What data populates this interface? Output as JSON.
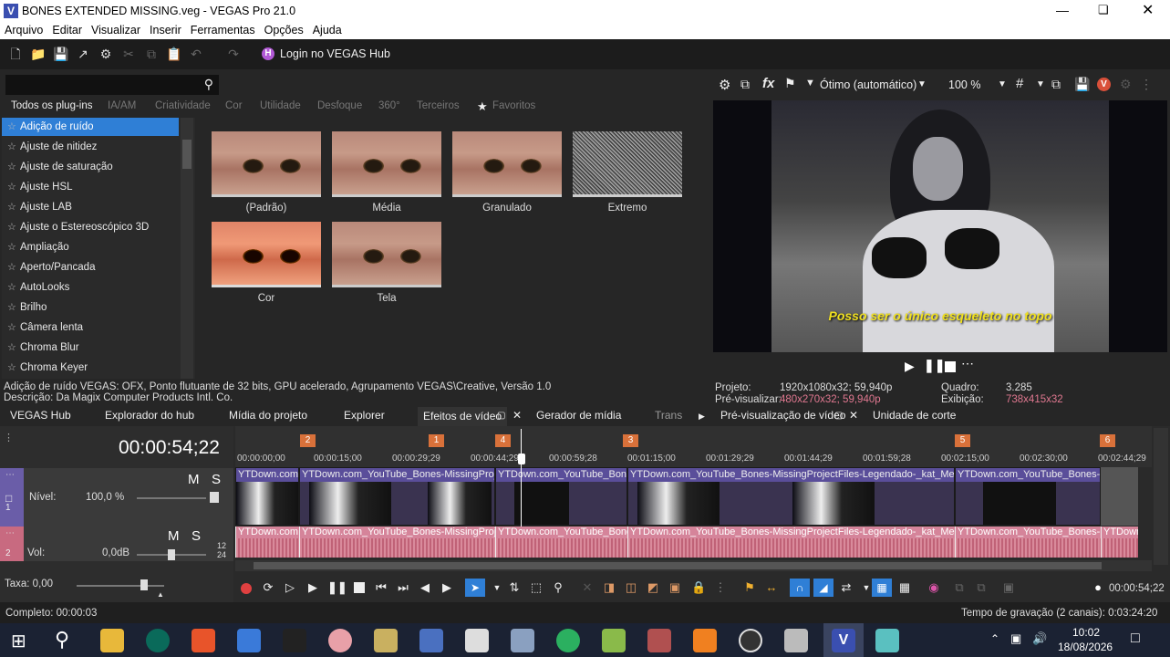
{
  "window": {
    "title": "BONES EXTENDED MISSING.veg - VEGAS Pro 21.0",
    "app_icon": "V"
  },
  "menu": [
    "Arquivo",
    "Editar",
    "Visualizar",
    "Inserir",
    "Ferramentas",
    "Opções",
    "Ajuda"
  ],
  "toolbar": {
    "hub_login": "Login no VEGAS Hub",
    "hub_badge": "H"
  },
  "plugins": {
    "categories": [
      "Todos os plug-ins",
      "IA/AM",
      "Criatividade",
      "Cor",
      "Utilidade",
      "Desfoque",
      "360°",
      "Terceiros",
      "Favoritos"
    ],
    "items": [
      "Adição de ruído",
      "Ajuste de nitidez",
      "Ajuste de saturação",
      "Ajuste HSL",
      "Ajuste LAB",
      "Ajuste o Estereoscópico 3D",
      "Ampliação",
      "Aperto/Pancada",
      "AutoLooks",
      "Brilho",
      "Câmera lenta",
      "Chroma Blur",
      "Chroma Keyer"
    ],
    "selected": "Adição de ruído",
    "presets": [
      "(Padrão)",
      "Média",
      "Granulado",
      "Extremo",
      "Cor",
      "Tela"
    ],
    "info_line1": "Adição de ruído VEGAS: OFX, Ponto flutuante de 32 bits, GPU acelerado,  Agrupamento VEGAS\\Creative,  Versão 1.0",
    "info_line2": "Descrição: Da Magix Computer Products Intl. Co."
  },
  "preview": {
    "quality": "Ótimo (automático)",
    "zoom": "100 %",
    "subtitle": "Posso ser o único esqueleto no topo",
    "projeto_label": "Projeto:",
    "projeto_val": "1920x1080x32; 59,940p",
    "previsualizar_label": "Pré-visualizar:",
    "previsualizar_val": "480x270x32; 59,940p",
    "quadro_label": "Quadro:",
    "quadro_val": "3.285",
    "exibicao_label": "Exibição:",
    "exibicao_val": "738x415x32"
  },
  "tabs": [
    "VEGAS Hub",
    "Explorador do hub",
    "Mídia do projeto",
    "Explorer",
    "Efeitos de vídeo",
    "Gerador de mídia",
    "Trans",
    "Pré-visualização de vídeo",
    "Unidade de corte"
  ],
  "timeline": {
    "timecode": "00:00:54;22",
    "ruler_ticks": [
      "00:00:00;00",
      "00:00:15;00",
      "00:00:29;29",
      "00:00:44;29",
      "00:00:59;28",
      "00:01:15;00",
      "00:01:29;29",
      "00:01:44;29",
      "00:01:59;28",
      "00:02:15;00",
      "00:02:30;00",
      "00:02:44;29"
    ],
    "markers": [
      "2",
      "1",
      "4",
      "3",
      "5",
      "6"
    ],
    "video_track": {
      "mute": "M",
      "solo": "S",
      "level_label": "Nível:",
      "level_value": "100,0 %",
      "num": "1"
    },
    "audio_track": {
      "mute": "M",
      "solo": "S",
      "vol_label": "Vol:",
      "vol_value": "0,0dB",
      "num": "2",
      "meter_a": "12",
      "meter_b": "24"
    },
    "clip_names": [
      "YTDown.com",
      "YTDown.com_YouTube_Bones-MissingProje",
      "YTDown.com_YouTube_Bone",
      "YTDown.com_YouTube_Bones-MissingProjectFiles-Legendado-_kat_Media",
      "YTDown.com_YouTube_Bones-M"
    ],
    "audio_clip_names": [
      "YTDown.com",
      "YTDown.com_YouTube_Bones-MissingProje",
      "YTDown.com_YouTube_Bone",
      "YTDown.com_YouTube_Bones-MissingProjectFiles-Legendado-_kat_Media",
      "YTDown.com_YouTube_Bones-M",
      "YTDown"
    ],
    "rate_label": "Taxa: 0,00",
    "end_time": "00:00:54;22"
  },
  "status": {
    "complete": "Completo: 00:00:03",
    "record": "Tempo de gravação (2 canais): 0:03:24:20"
  },
  "taskbar": {
    "time": "10:02",
    "date": "18/08/2026"
  },
  "colors": {
    "accent": "#2f7fd6",
    "marker": "#d9713a",
    "video_clip": "#5a4e9a",
    "audio_clip": "#c86a80",
    "subtitle": "#f0e020"
  }
}
